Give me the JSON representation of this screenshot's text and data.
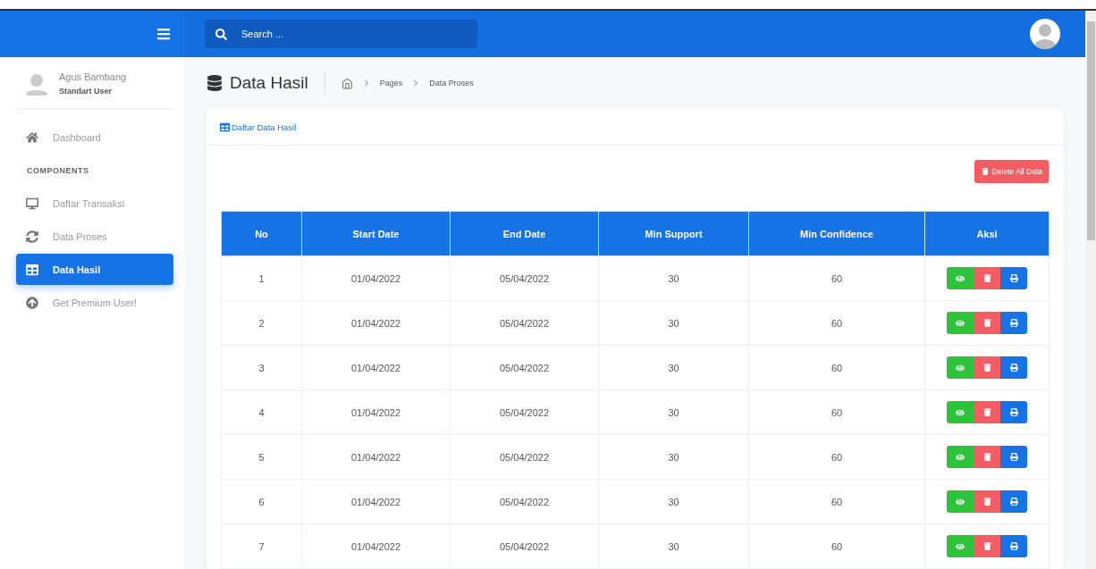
{
  "search": {
    "placeholder": "Search ..."
  },
  "user": {
    "name": "Agus Bambang",
    "role": "Standart User"
  },
  "sidebar": {
    "items": [
      {
        "kind": "link",
        "label": "Dashboard",
        "selected": false
      },
      {
        "kind": "heading",
        "label": "COMPONENTS"
      },
      {
        "kind": "link",
        "label": "Daftar Transaksi",
        "selected": false
      },
      {
        "kind": "link",
        "label": "Data Proses",
        "selected": false
      },
      {
        "kind": "link",
        "label": "Data Hasil",
        "selected": true
      },
      {
        "kind": "link",
        "label": "Get Premium User!",
        "selected": false
      }
    ]
  },
  "page": {
    "title": "Data Hasil",
    "breadcrumb": [
      "Pages",
      "Data Proses"
    ]
  },
  "card": {
    "title": "Daftar Data Hasil",
    "delete_all_button": "Delete All Data"
  },
  "table": {
    "columns": [
      "No",
      "Start Date",
      "End Date",
      "Min Support",
      "Min Confidence",
      "Aksi"
    ],
    "rows": [
      {
        "no": "1",
        "start_date": "01/04/2022",
        "end_date": "05/04/2022",
        "min_support": "30",
        "min_confidence": "60"
      },
      {
        "no": "2",
        "start_date": "01/04/2022",
        "end_date": "05/04/2022",
        "min_support": "30",
        "min_confidence": "60"
      },
      {
        "no": "3",
        "start_date": "01/04/2022",
        "end_date": "05/04/2022",
        "min_support": "30",
        "min_confidence": "60"
      },
      {
        "no": "4",
        "start_date": "01/04/2022",
        "end_date": "05/04/2022",
        "min_support": "30",
        "min_confidence": "60"
      },
      {
        "no": "5",
        "start_date": "01/04/2022",
        "end_date": "05/04/2022",
        "min_support": "30",
        "min_confidence": "60"
      },
      {
        "no": "6",
        "start_date": "01/04/2022",
        "end_date": "05/04/2022",
        "min_support": "30",
        "min_confidence": "60"
      },
      {
        "no": "7",
        "start_date": "01/04/2022",
        "end_date": "05/04/2022",
        "min_support": "30",
        "min_confidence": "60"
      }
    ]
  }
}
